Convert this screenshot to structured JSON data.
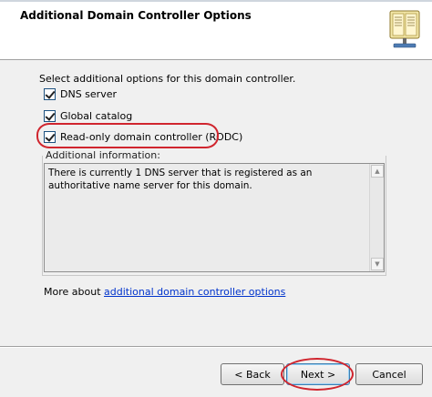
{
  "header": {
    "title": "Additional Domain Controller Options",
    "icon": "server-book-icon"
  },
  "intro": "Select additional options for this domain controller.",
  "options": [
    {
      "label": "DNS server",
      "checked": true
    },
    {
      "label": "Global catalog",
      "checked": true
    },
    {
      "label": "Read-only domain controller (RODC)",
      "checked": true
    }
  ],
  "info": {
    "label": "Additional information:",
    "text": "There is currently 1 DNS server that is registered as an authoritative name server for this domain."
  },
  "more": {
    "prefix": "More about",
    "link": "additional domain controller options"
  },
  "buttons": {
    "back": "< Back",
    "next": "Next >",
    "cancel": "Cancel"
  },
  "colors": {
    "highlight_ring": "#d0252e",
    "link": "#0033cc"
  }
}
